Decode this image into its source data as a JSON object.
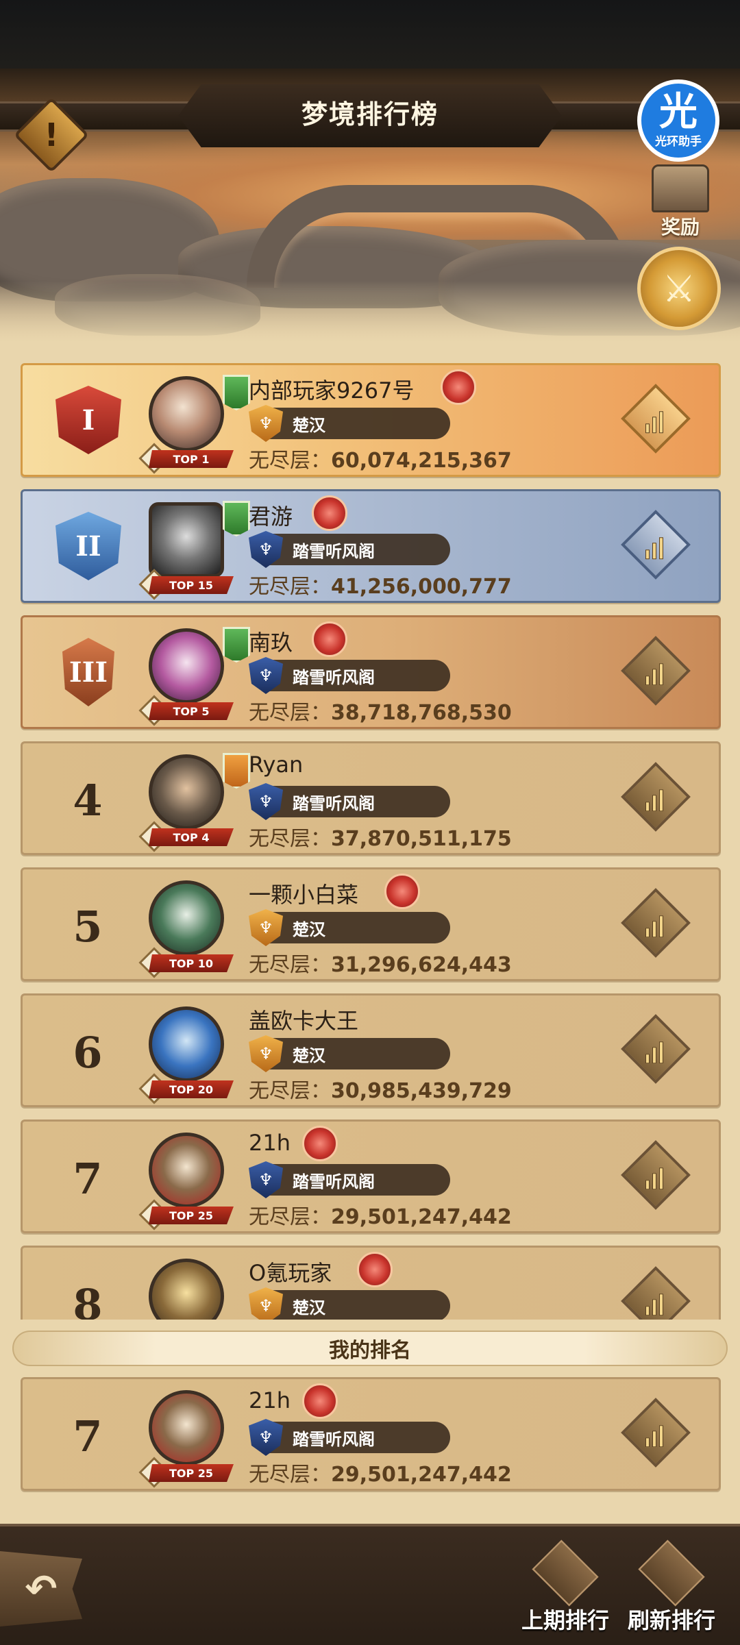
{
  "header": {
    "title": "梦境排行榜",
    "alert_symbol": "!",
    "helper_badge_glyph": "光",
    "helper_badge_label": "光环助手",
    "reward_label": "奖励"
  },
  "score_label": "无尽层：",
  "rows": [
    {
      "rank": "I",
      "name": "内部玩家9267号",
      "guild": "楚汉",
      "guild_color": "orange",
      "score": "60,074,215,367",
      "top_badge": "TOP 1"
    },
    {
      "rank": "II",
      "name": "君游",
      "guild": "踏雪听风阁",
      "guild_color": "blue",
      "score": "41,256,000,777",
      "top_badge": "TOP 15"
    },
    {
      "rank": "III",
      "name": "南玖",
      "guild": "踏雪听风阁",
      "guild_color": "blue",
      "score": "38,718,768,530",
      "top_badge": "TOP 5"
    },
    {
      "rank": "4",
      "name": "Ryan",
      "guild": "踏雪听风阁",
      "guild_color": "blue",
      "score": "37,870,511,175",
      "top_badge": "TOP 4"
    },
    {
      "rank": "5",
      "name": "一颗小白菜",
      "guild": "楚汉",
      "guild_color": "orange",
      "score": "31,296,624,443",
      "top_badge": "TOP 10"
    },
    {
      "rank": "6",
      "name": "盖欧卡大王",
      "guild": "楚汉",
      "guild_color": "orange",
      "score": "30,985,439,729",
      "top_badge": "TOP 20"
    },
    {
      "rank": "7",
      "name": "21h",
      "guild": "踏雪听风阁",
      "guild_color": "blue",
      "score": "29,501,247,442",
      "top_badge": "TOP 25"
    },
    {
      "rank": "8",
      "name": "O氪玩家",
      "guild": "楚汉",
      "guild_color": "orange",
      "score": "",
      "top_badge": ""
    }
  ],
  "my_rank": {
    "section_label": "我的排名",
    "rank": "7",
    "name": "21h",
    "guild": "踏雪听风阁",
    "guild_color": "blue",
    "score": "29,501,247,442",
    "top_badge": "TOP 25"
  },
  "bottom_bar": {
    "back_symbol": "↶",
    "last_period_label": "上期排行",
    "refresh_label": "刷新排行"
  }
}
